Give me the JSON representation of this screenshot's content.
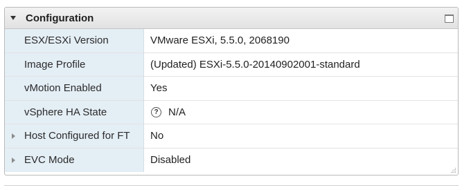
{
  "panel": {
    "title": "Configuration",
    "collapse_icon": "triangle-down-icon",
    "maximize_icon": "maximize-icon"
  },
  "rows": [
    {
      "label": "ESX/ESXi Version",
      "value": "VMware ESXi, 5.5.0, 2068190",
      "expandable": false
    },
    {
      "label": "Image Profile",
      "value": "(Updated) ESXi-5.5.0-20140902001-standard",
      "expandable": false
    },
    {
      "label": "vMotion Enabled",
      "value": "Yes",
      "expandable": false
    },
    {
      "label": "vSphere HA State",
      "value": "N/A",
      "expandable": false,
      "icon": "help-icon",
      "icon_glyph": "?"
    },
    {
      "label": "Host Configured for FT",
      "value": "No",
      "expandable": true
    },
    {
      "label": "EVC Mode",
      "value": "Disabled",
      "expandable": true
    }
  ],
  "colors": {
    "label_background": "#e4eef5",
    "header_background": "#e8e8e8",
    "border": "#b9b9b9"
  }
}
